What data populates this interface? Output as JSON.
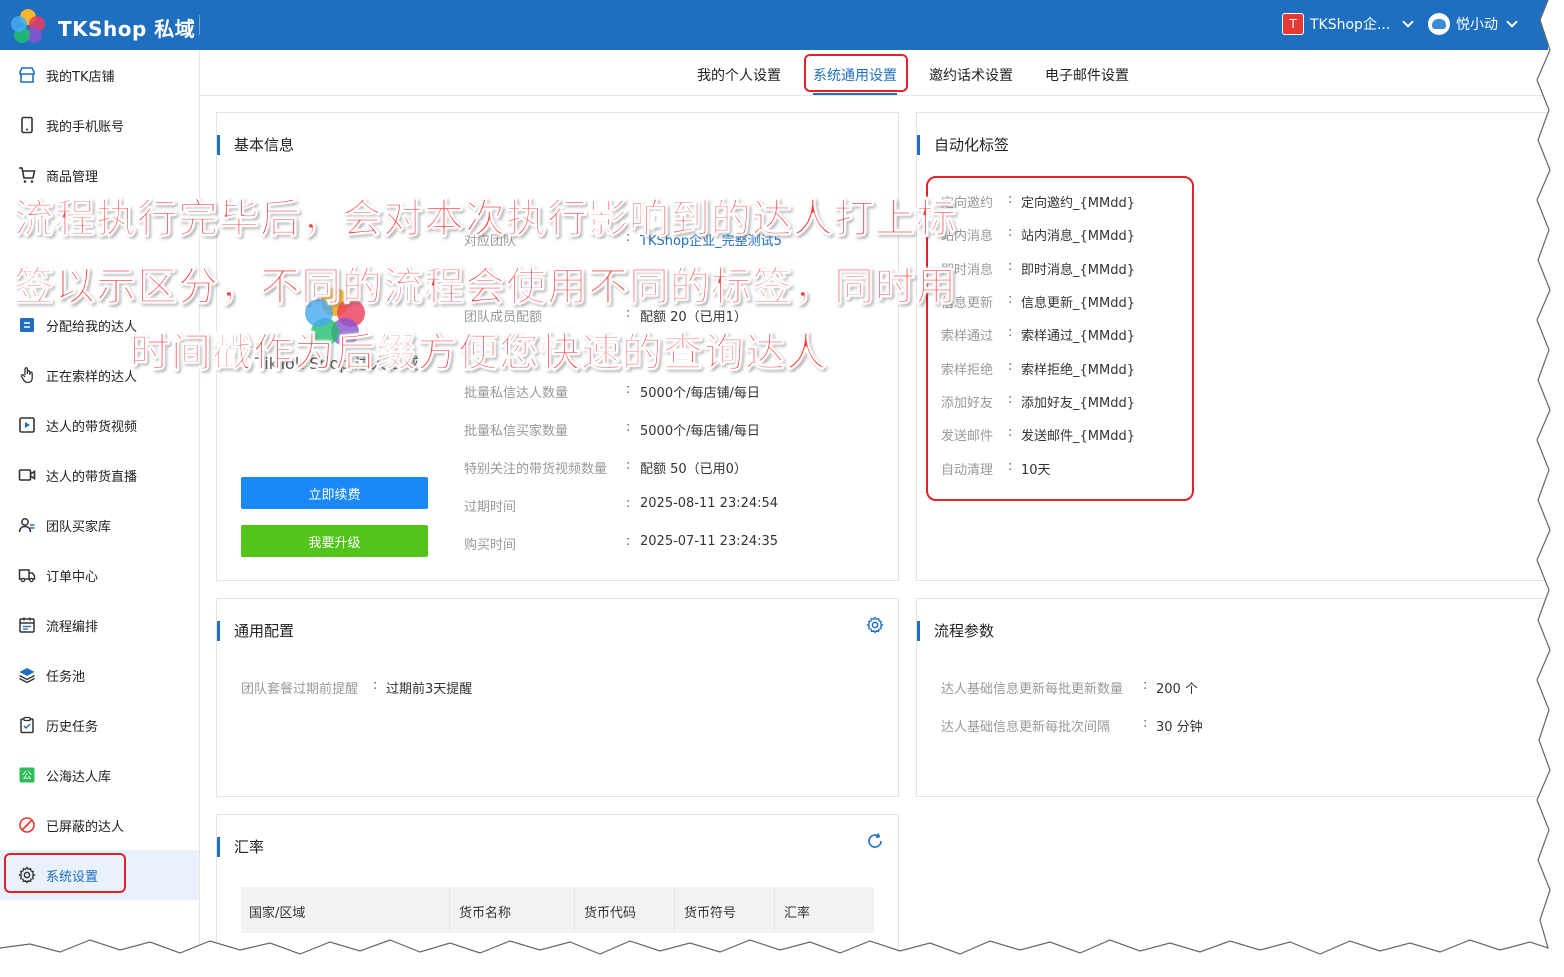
{
  "app": {
    "title": "TKShop 私域"
  },
  "header": {
    "shop_badge": "T",
    "shop_name": "TKShop企...",
    "user_name": "悦小动"
  },
  "sidebar": {
    "items": [
      {
        "label": "我的TK店铺",
        "icon": "store-icon"
      },
      {
        "label": "我的手机账号",
        "icon": "phone-icon"
      },
      {
        "label": "商品管理",
        "icon": "cart-icon"
      },
      {
        "label": "",
        "icon": "creator-icon"
      },
      {
        "label": "",
        "icon": "creator-icon"
      },
      {
        "label": "分配给我的达人",
        "icon": "assigned-icon"
      },
      {
        "label": "正在索样的达人",
        "icon": "hand-icon"
      },
      {
        "label": "达人的带货视频",
        "icon": "video-icon"
      },
      {
        "label": "达人的带货直播",
        "icon": "live-icon"
      },
      {
        "label": "团队买家库",
        "icon": "buyers-icon"
      },
      {
        "label": "订单中心",
        "icon": "truck-icon"
      },
      {
        "label": "流程编排",
        "icon": "flow-icon"
      },
      {
        "label": "任务池",
        "icon": "layers-icon"
      },
      {
        "label": "历史任务",
        "icon": "clipboard-icon"
      },
      {
        "label": "公海达人库",
        "icon": "public-icon"
      },
      {
        "label": "已屏蔽的达人",
        "icon": "block-icon"
      },
      {
        "label": "系统设置",
        "icon": "gear-icon"
      }
    ]
  },
  "tabs": [
    "我的个人设置",
    "系统通用设置",
    "邀约话术设置",
    "电子邮件设置"
  ],
  "basic_info": {
    "title": "基本信息",
    "logo_text": "TikTok Shop 达人私域",
    "rows": [
      {
        "label": "对应团队",
        "value": "TKShop企业_完整测试5"
      },
      {
        "label": "团队成员配额",
        "value": "配额 20（已用1）"
      },
      {
        "label": "批量私信达人数量",
        "value": "5000个/每店铺/每日"
      },
      {
        "label": "批量私信买家数量",
        "value": "5000个/每店铺/每日"
      },
      {
        "label": "特别关注的带货视频数量",
        "value": "配额 50（已用0）"
      },
      {
        "label": "过期时间",
        "value": "2025-08-11 23:24:54"
      },
      {
        "label": "购买时间",
        "value": "2025-07-11 23:24:35"
      }
    ],
    "renew_button": "立即续费",
    "upgrade_button": "我要升级"
  },
  "auto_tags": {
    "title": "自动化标签",
    "rows": [
      {
        "label": "定向邀约",
        "value": "定向邀约_{MMdd}"
      },
      {
        "label": "站内消息",
        "value": "站内消息_{MMdd}"
      },
      {
        "label": "即时消息",
        "value": "即时消息_{MMdd}"
      },
      {
        "label": "信息更新",
        "value": "信息更新_{MMdd}"
      },
      {
        "label": "索样通过",
        "value": "索样通过_{MMdd}"
      },
      {
        "label": "索样拒绝",
        "value": "索样拒绝_{MMdd}"
      },
      {
        "label": "添加好友",
        "value": "添加好友_{MMdd}"
      },
      {
        "label": "发送邮件",
        "value": "发送邮件_{MMdd}"
      },
      {
        "label": "自动清理",
        "value": "10天"
      }
    ]
  },
  "general_config": {
    "title": "通用配置",
    "label": "团队套餐过期前提醒",
    "value": "过期前3天提醒"
  },
  "flow_params": {
    "title": "流程参数",
    "rows": [
      {
        "label": "达人基础信息更新每批更新数量",
        "value": "200 个"
      },
      {
        "label": "达人基础信息更新每批次间隔",
        "value": "30 分钟"
      }
    ]
  },
  "exchange": {
    "title": "汇率",
    "columns": [
      "国家/区域",
      "货币名称",
      "货币代码",
      "货币符号",
      "汇率"
    ]
  },
  "annotation": {
    "line1": "流程执行完毕后，会对本次执行影响到的达人打上标",
    "line2": "签以示区分，不同的流程会使用不同的标签，同时用",
    "line3": "时间戳作为后缀方便您快速的查询达人"
  },
  "colors": {
    "brand": "#1f6fc1",
    "highlight": "#e0232b",
    "renew": "#1a88f7",
    "upgrade": "#52c41a"
  }
}
